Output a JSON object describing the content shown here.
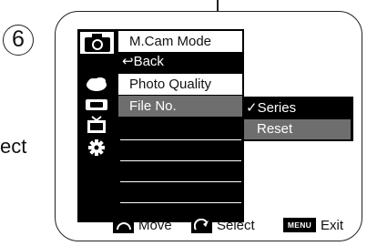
{
  "step_number": "6",
  "edge_text": "ect",
  "menu": {
    "title": "M.Cam Mode",
    "back": "↩Back",
    "items": [
      {
        "label": "Photo Quality",
        "selected": false
      },
      {
        "label": "File No.",
        "selected": true
      }
    ]
  },
  "submenu": {
    "series": "✓Series",
    "reset": "Reset"
  },
  "tabs": [
    "camera-icon",
    "shade-icon",
    "tape-icon",
    "tv-icon",
    "settings-gear-icon"
  ],
  "hints": {
    "move": "Move",
    "select": "Select",
    "menu_key": "MENU",
    "exit": "Exit"
  }
}
